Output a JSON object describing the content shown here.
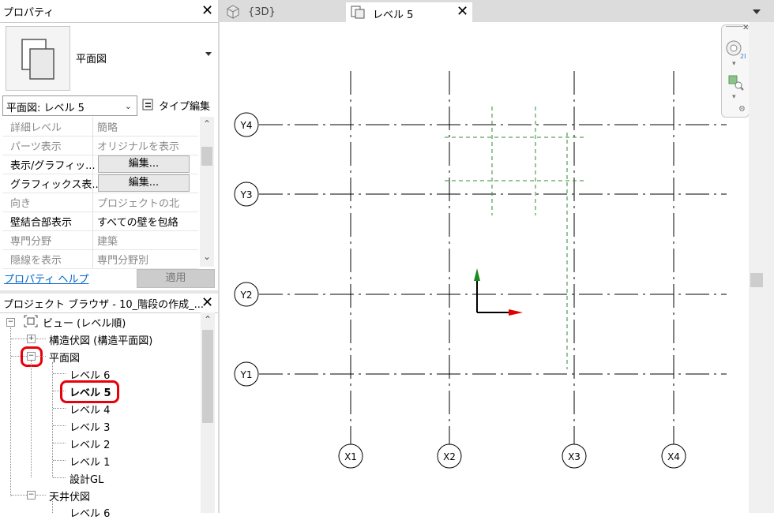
{
  "properties": {
    "title": "プロパティ",
    "type_name": "平面図",
    "selector": "平面図: レベル 5",
    "type_edit": "タイプ編集",
    "rows": [
      {
        "label": "詳細レベル",
        "value": "簡略",
        "enabled": false
      },
      {
        "label": "パーツ表示",
        "value": "オリジナルを表示",
        "enabled": false
      },
      {
        "label": "表示/グラフィッ...",
        "value": "編集...",
        "enabled": true,
        "button": true
      },
      {
        "label": "グラフィックス表...",
        "value": "編集...",
        "enabled": true,
        "button": true
      },
      {
        "label": "向き",
        "value": "プロジェクトの北",
        "enabled": false
      },
      {
        "label": "壁結合部表示",
        "value": "すべての壁を包絡",
        "enabled": true
      },
      {
        "label": "専門分野",
        "value": "建築",
        "enabled": false
      },
      {
        "label": "隠線を表示",
        "value": "専門分野別",
        "enabled": false
      }
    ],
    "help_link": "プロパティ ヘルプ",
    "apply": "適用"
  },
  "browser": {
    "title": "プロジェクト ブラウザ - 10_階段の作成_...",
    "root": "ビュー (レベル順)",
    "structural": "構造伏図 (構造平面図)",
    "floor_plans": "平面図",
    "levels": [
      "レベル 6",
      "レベル 5",
      "レベル 4",
      "レベル 3",
      "レベル 2",
      "レベル 1",
      "設計GL"
    ],
    "selected_level": "レベル 5",
    "ceiling": "天井伏図",
    "ceiling_first": "レベル 6"
  },
  "tabs": [
    {
      "label": "{3D}",
      "active": false
    },
    {
      "label": "レベル 5",
      "active": true
    }
  ],
  "grid": {
    "vertical": [
      "X1",
      "X2",
      "X3",
      "X4"
    ],
    "horizontal": [
      "Y4",
      "Y3",
      "Y2",
      "Y1"
    ]
  },
  "colors": {
    "selection_ring": "#e8000b",
    "link": "#0066cc",
    "gizmo_y": "#1a8a1a",
    "gizmo_x": "#e00000",
    "dashed_green": "#2e8b2e"
  }
}
